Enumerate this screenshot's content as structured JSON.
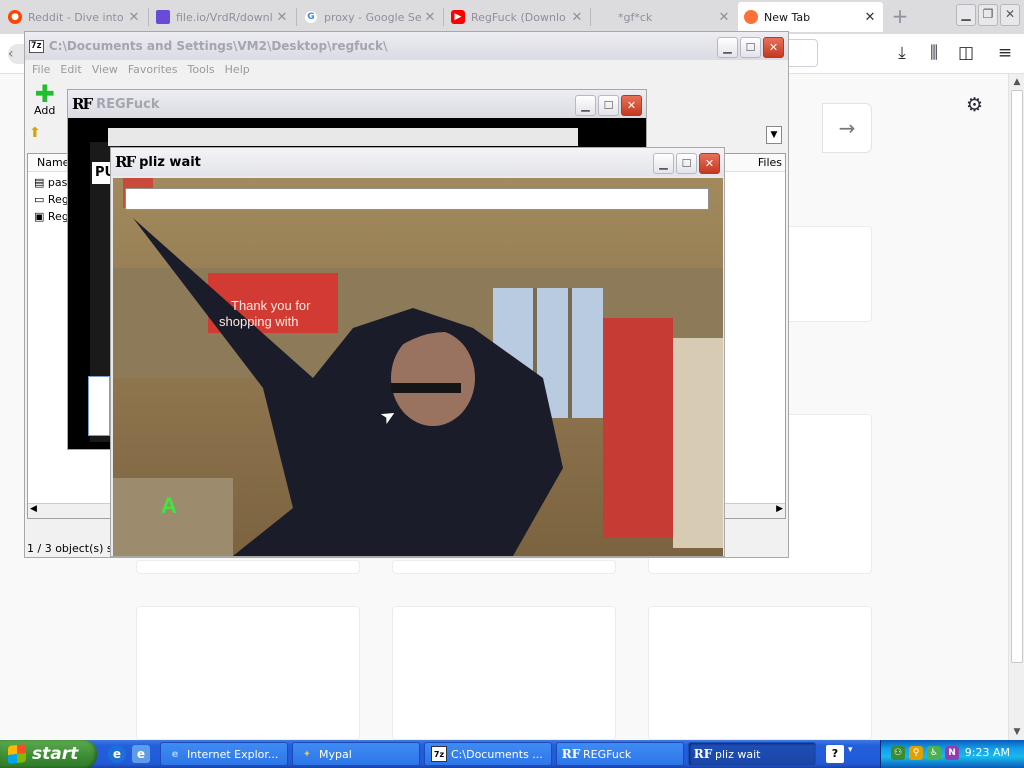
{
  "browser": {
    "tabs": [
      {
        "label": "Reddit - Dive into",
        "icon": "reddit-icon",
        "color": "#ff4500"
      },
      {
        "label": "file.io/VrdR/downl",
        "icon": "fileio-icon",
        "color": "#6a4bd8"
      },
      {
        "label": "proxy - Google Se",
        "icon": "google-icon",
        "color": "#4285f4"
      },
      {
        "label": "RegFuck (Downlo",
        "icon": "youtube-icon",
        "color": "#ff0000"
      },
      {
        "label": "*gf*ck",
        "icon": "blank-icon",
        "color": "#cccccc"
      },
      {
        "label": "New Tab",
        "icon": "firefox-icon",
        "color": "#ff7139"
      }
    ],
    "new_tab_symbol": "+",
    "close_symbol": "✕"
  },
  "zip_window": {
    "title": "C:\\Documents and Settings\\VM2\\Desktop\\regfuck\\",
    "badge": "7z",
    "menu": [
      "File",
      "Edit",
      "View",
      "Favorites",
      "Tools",
      "Help"
    ],
    "add_label": "Add",
    "column_name": "Name",
    "column_files": "Files",
    "files": [
      "pas",
      "Reg",
      "Reg"
    ],
    "status": "1 / 3 object(s) se"
  },
  "regfuck_window": {
    "title": "REGFuck",
    "badge": "RF",
    "partial_text": "PU"
  },
  "wait_window": {
    "title": "pliz wait",
    "badge": "RF",
    "sign_text_line1": "Thank you for",
    "sign_text_line2": "shopping with",
    "progress": 0
  },
  "taskbar": {
    "start_label": "start",
    "tasks": [
      {
        "label": "Internet Explor...",
        "icon": "ie-icon"
      },
      {
        "label": "Mypal",
        "icon": "mypal-icon"
      },
      {
        "label": "C:\\Documents ...",
        "icon": "7zip-icon"
      },
      {
        "label": "REGFuck",
        "icon": "regfuck-icon"
      },
      {
        "label": "pliz wait",
        "icon": "regfuck-icon"
      }
    ],
    "clock": "9:23 AM"
  }
}
